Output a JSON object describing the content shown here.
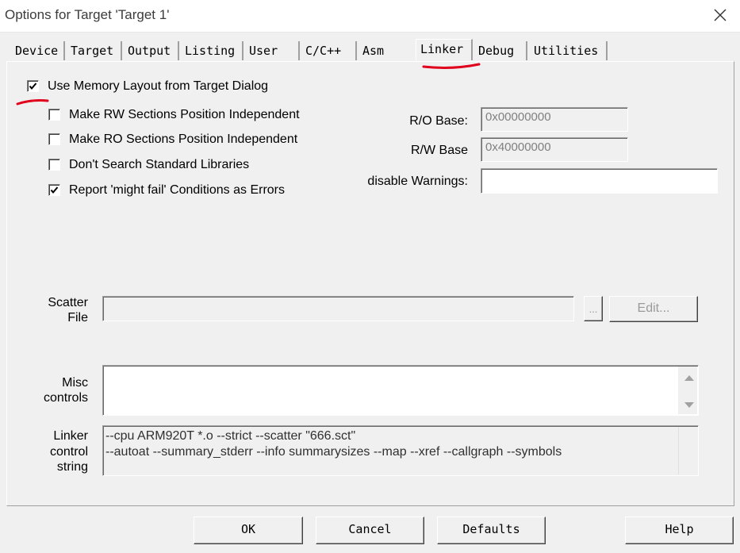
{
  "window": {
    "title": "Options for Target 'Target 1'"
  },
  "tabs": [
    {
      "label": "Device"
    },
    {
      "label": "Target"
    },
    {
      "label": "Output"
    },
    {
      "label": "Listing"
    },
    {
      "label": "User"
    },
    {
      "label": "C/C++"
    },
    {
      "label": "Asm"
    },
    {
      "label": "Linker",
      "active": true
    },
    {
      "label": "Debug"
    },
    {
      "label": "Utilities"
    }
  ],
  "linker": {
    "use_memory_layout": {
      "label": "Use Memory Layout from Target Dialog",
      "checked": true
    },
    "options": [
      {
        "label": "Make RW Sections Position Independent",
        "checked": false
      },
      {
        "label": "Make RO Sections Position Independent",
        "checked": false
      },
      {
        "label": "Don't Search Standard Libraries",
        "checked": false
      },
      {
        "label": "Report 'might fail' Conditions as Errors",
        "checked": true
      }
    ],
    "ro_base": {
      "label": "R/O Base:",
      "value": "0x00000000"
    },
    "rw_base": {
      "label": "R/W Base",
      "value": "0x40000000"
    },
    "disable_warnings": {
      "label": "disable Warnings:",
      "value": ""
    },
    "scatter_file": {
      "label_line1": "Scatter",
      "label_line2": "File",
      "value": "",
      "browse_label": "...",
      "edit_label": "Edit..."
    },
    "misc_controls": {
      "label_line1": "Misc",
      "label_line2": "controls",
      "value": ""
    },
    "linker_control_string": {
      "label_line1": "Linker",
      "label_line2": "control",
      "label_line3": "string",
      "line1": "--cpu ARM920T *.o --strict --scatter \"666.sct\"",
      "line2": "--autoat --summary_stderr --info summarysizes --map --xref --callgraph --symbols"
    }
  },
  "buttons": {
    "ok": "OK",
    "cancel": "Cancel",
    "defaults": "Defaults",
    "help": "Help"
  },
  "colors": {
    "annotation_red": "#e0001b",
    "dialog_bg": "#f0f0f0"
  }
}
